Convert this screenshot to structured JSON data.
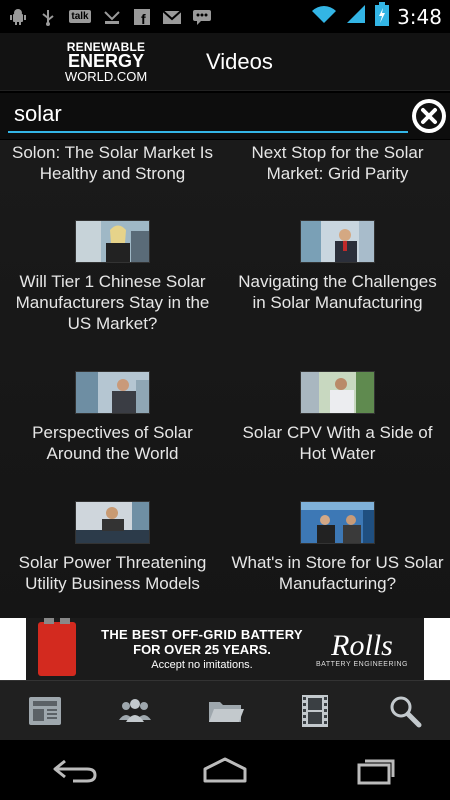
{
  "status_bar": {
    "time": "3:48",
    "icons": [
      "android-icon",
      "usb-icon",
      "talk-icon",
      "missed-call-icon",
      "facebook-icon",
      "gmail-icon",
      "chat-icon",
      "wifi-icon",
      "signal-icon",
      "battery-charging-icon"
    ],
    "talk_label": "talk"
  },
  "action_bar": {
    "logo": {
      "line1": "RENEWABLE",
      "line2": "ENERGY",
      "line3": "WORLD.COM"
    },
    "title": "Videos"
  },
  "search": {
    "value": "solar",
    "accent_color": "#33b5e5"
  },
  "videos": [
    {
      "title": "Solon: The Solar Market Is Healthy and Strong",
      "has_thumb": false
    },
    {
      "title": "Next Stop for the Solar Market: Grid Parity",
      "has_thumb": false
    },
    {
      "title": "Will Tier 1 Chinese Solar Manufacturers Stay in the US Market?",
      "has_thumb": true
    },
    {
      "title": "Navigating the Challenges in Solar Manufacturing",
      "has_thumb": true
    },
    {
      "title": "Perspectives of Solar Around the World",
      "has_thumb": true
    },
    {
      "title": "Solar CPV With a Side of Hot Water",
      "has_thumb": true
    },
    {
      "title": "Solar Power Threatening Utility Business Models",
      "has_thumb": true
    },
    {
      "title": "What's in Store for US Solar Manufacturing?",
      "has_thumb": true
    }
  ],
  "ad": {
    "line1": "THE BEST OFF-GRID BATTERY",
    "line2": "FOR OVER 25 YEARS.",
    "line3": "Accept no imitations.",
    "brand": "Rolls",
    "brand_sub": "BATTERY ENGINEERING"
  },
  "tabs": [
    {
      "icon": "news-icon"
    },
    {
      "icon": "people-icon"
    },
    {
      "icon": "folder-icon"
    },
    {
      "icon": "film-icon",
      "active": true
    },
    {
      "icon": "search-icon"
    }
  ],
  "navbar": [
    "back-icon",
    "home-icon",
    "recent-apps-icon"
  ]
}
